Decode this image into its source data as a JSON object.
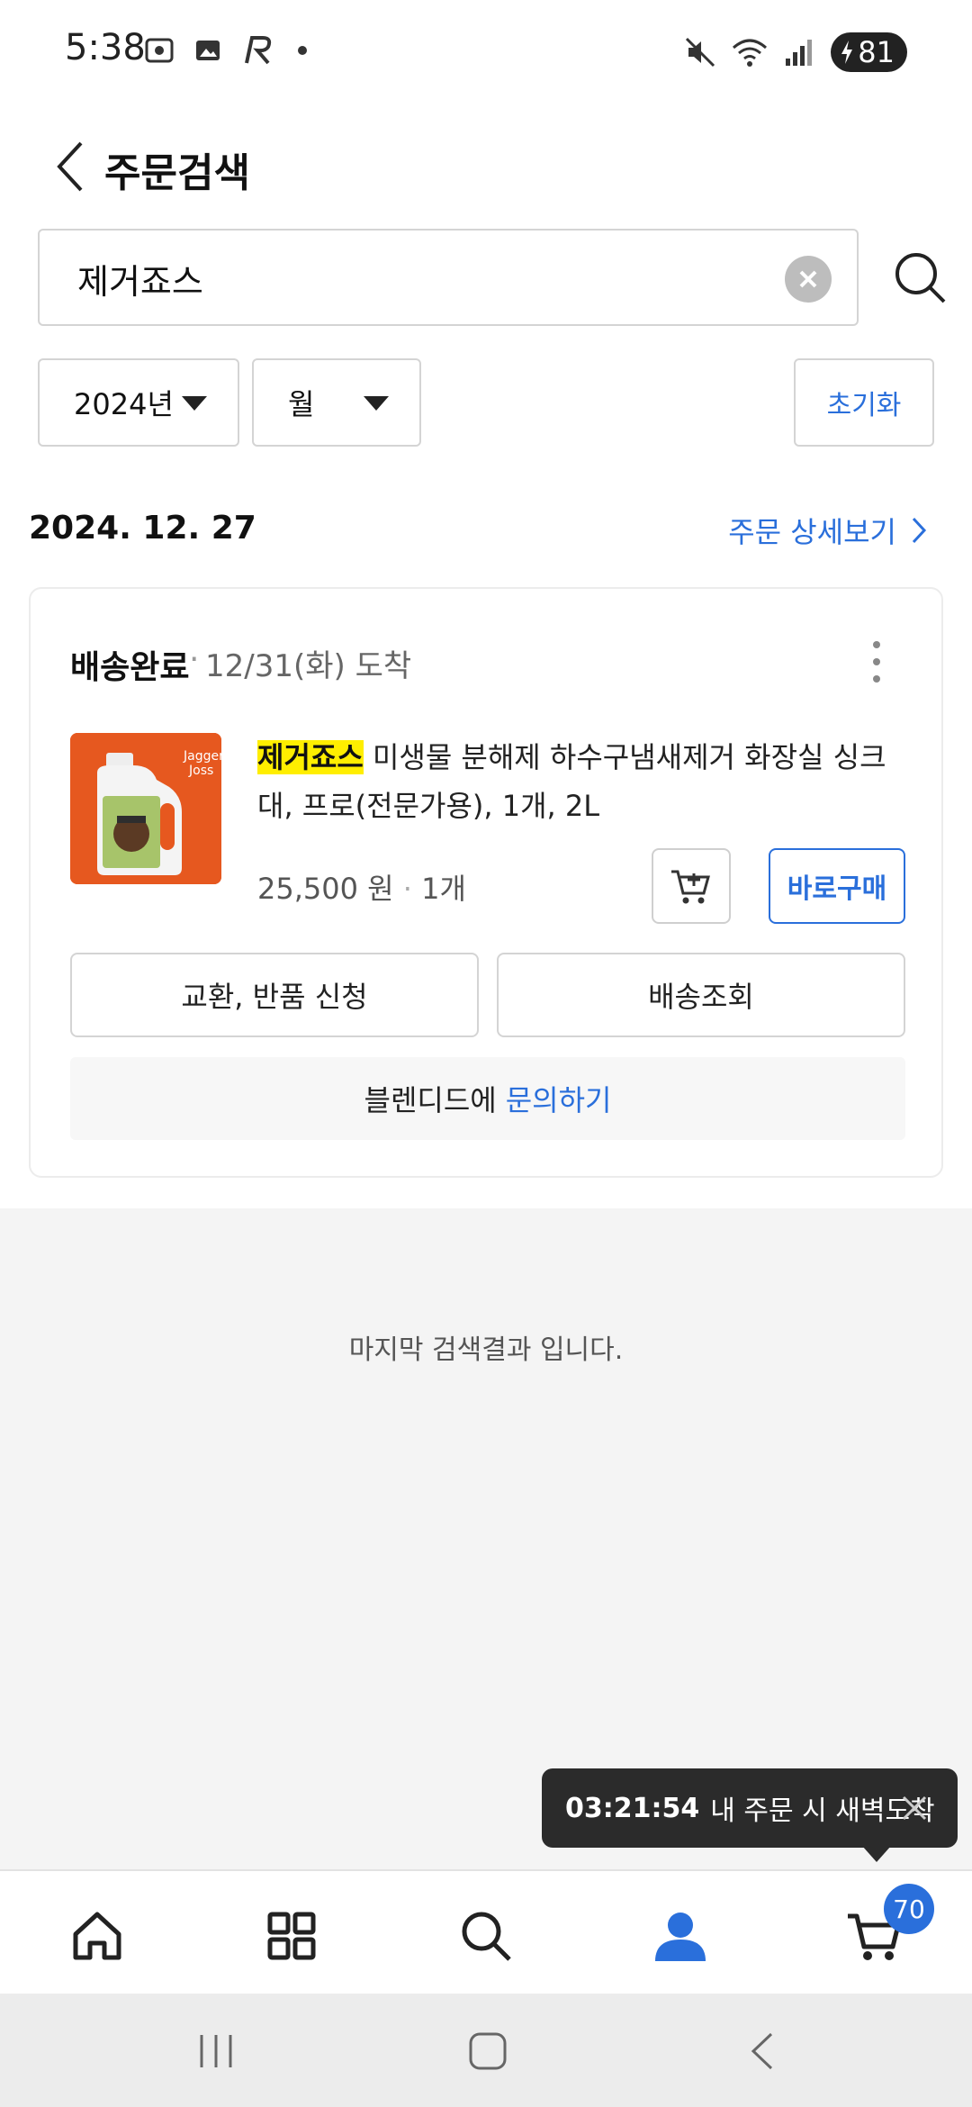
{
  "status_bar": {
    "time": "5:38",
    "battery": "81"
  },
  "header": {
    "title": "주문검색"
  },
  "search": {
    "value": "제거죠스"
  },
  "filters": {
    "year": "2024년",
    "month": "월",
    "reset_label": "초기화"
  },
  "order": {
    "date": "2024. 12. 27",
    "detail_link": "주문 상세보기",
    "status": "배송완료",
    "separator": "·",
    "arrival": "12/31(화) 도착",
    "product": {
      "highlight": "제거죠스",
      "name_rest": " 미생물 분해제 하수구냄새제거 화장실 싱크대, 프로(전문가용), 1개, 2L",
      "price": "25,500 원",
      "price_sep": "·",
      "quantity": "1개",
      "thumb_text": "Jagger Joss"
    },
    "buy_now_label": "바로구매",
    "exchange_label": "교환, 반품 신청",
    "tracking_label": "배송조회",
    "inquiry_prefix": "블렌디드에",
    "inquiry_link": "문의하기"
  },
  "end_message": "마지막 검색결과 입니다.",
  "toast": {
    "timer": "03:21:54",
    "message": "내 주문 시 새벽도착"
  },
  "bottom_nav": {
    "cart_badge": "70"
  },
  "colors": {
    "accent": "#2a6fdb",
    "highlight": "#ffee00",
    "product_bg": "#e6581f"
  }
}
